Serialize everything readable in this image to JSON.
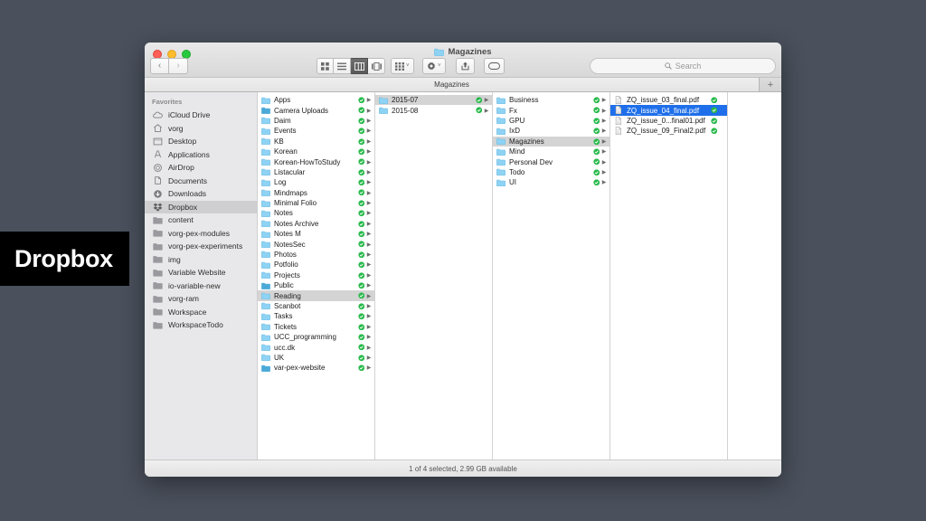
{
  "overlay": {
    "caption": "Dropbox"
  },
  "window": {
    "title": "Magazines",
    "title_icon": "folder-icon",
    "traffic_lights": [
      "close-button",
      "minimize-button",
      "maximize-button"
    ]
  },
  "toolbar": {
    "back_label": "‹",
    "forward_label": "›",
    "view_modes": [
      {
        "name": "icon-view",
        "label": "icon",
        "active": false
      },
      {
        "name": "list-view",
        "label": "list",
        "active": false
      },
      {
        "name": "column-view",
        "label": "column",
        "active": true
      },
      {
        "name": "gallery-view",
        "label": "gallery",
        "active": false
      }
    ],
    "arrange_label": "arrange",
    "action_label": "action",
    "share_label": "share",
    "tag_label": "tag",
    "chevron": "˅"
  },
  "search": {
    "placeholder": "Search",
    "value": "",
    "icon": "search-icon"
  },
  "tabs": {
    "items": [
      {
        "label": "Magazines",
        "active": true
      }
    ],
    "new_tab_label": "+"
  },
  "sidebar": {
    "header": "Favorites",
    "items": [
      {
        "label": "iCloud Drive",
        "icon": "cloud-icon",
        "selected": false
      },
      {
        "label": "vorg",
        "icon": "home-icon",
        "selected": false
      },
      {
        "label": "Desktop",
        "icon": "desktop-icon",
        "selected": false
      },
      {
        "label": "Applications",
        "icon": "applications-icon",
        "selected": false
      },
      {
        "label": "AirDrop",
        "icon": "airdrop-icon",
        "selected": false
      },
      {
        "label": "Documents",
        "icon": "documents-icon",
        "selected": false
      },
      {
        "label": "Downloads",
        "icon": "downloads-icon",
        "selected": false
      },
      {
        "label": "Dropbox",
        "icon": "dropbox-icon",
        "selected": true
      },
      {
        "label": "content",
        "icon": "folder-icon",
        "selected": false
      },
      {
        "label": "vorg-pex-modules",
        "icon": "folder-icon",
        "selected": false
      },
      {
        "label": "vorg-pex-experiments",
        "icon": "folder-icon",
        "selected": false
      },
      {
        "label": "img",
        "icon": "folder-icon",
        "selected": false
      },
      {
        "label": "Variable Website",
        "icon": "folder-icon",
        "selected": false
      },
      {
        "label": "io-variable-new",
        "icon": "folder-icon",
        "selected": false
      },
      {
        "label": "vorg-ram",
        "icon": "folder-icon",
        "selected": false
      },
      {
        "label": "Workspace",
        "icon": "folder-icon",
        "selected": false
      },
      {
        "label": "WorkspaceTodo",
        "icon": "folder-icon",
        "selected": false
      }
    ]
  },
  "columns": [
    {
      "name": "column-1",
      "rows": [
        {
          "label": "Apps",
          "icon": "folder-icon",
          "sync": true,
          "arrow": true,
          "selected": "none"
        },
        {
          "label": "Camera Uploads",
          "icon": "folder-special-icon",
          "sync": true,
          "arrow": true,
          "selected": "none"
        },
        {
          "label": "Daim",
          "icon": "folder-icon",
          "sync": true,
          "arrow": true,
          "selected": "none"
        },
        {
          "label": "Events",
          "icon": "folder-icon",
          "sync": true,
          "arrow": true,
          "selected": "none"
        },
        {
          "label": "KB",
          "icon": "folder-icon",
          "sync": true,
          "arrow": true,
          "selected": "none"
        },
        {
          "label": "Korean",
          "icon": "folder-icon",
          "sync": true,
          "arrow": true,
          "selected": "none"
        },
        {
          "label": "Korean-HowToStudy",
          "icon": "folder-icon",
          "sync": true,
          "arrow": true,
          "selected": "none"
        },
        {
          "label": "Listacular",
          "icon": "folder-icon",
          "sync": true,
          "arrow": true,
          "selected": "none"
        },
        {
          "label": "Log",
          "icon": "folder-icon",
          "sync": true,
          "arrow": true,
          "selected": "none"
        },
        {
          "label": "Mindmaps",
          "icon": "folder-icon",
          "sync": true,
          "arrow": true,
          "selected": "none"
        },
        {
          "label": "Minimal Folio",
          "icon": "folder-icon",
          "sync": true,
          "arrow": true,
          "selected": "none"
        },
        {
          "label": "Notes",
          "icon": "folder-icon",
          "sync": true,
          "arrow": true,
          "selected": "none"
        },
        {
          "label": "Notes Archive",
          "icon": "folder-icon",
          "sync": true,
          "arrow": true,
          "selected": "none"
        },
        {
          "label": "Notes M",
          "icon": "folder-icon",
          "sync": true,
          "arrow": true,
          "selected": "none"
        },
        {
          "label": "NotesSec",
          "icon": "folder-icon",
          "sync": true,
          "arrow": true,
          "selected": "none"
        },
        {
          "label": "Photos",
          "icon": "folder-icon",
          "sync": true,
          "arrow": true,
          "selected": "none"
        },
        {
          "label": "Potfolio",
          "icon": "folder-icon",
          "sync": true,
          "arrow": true,
          "selected": "none"
        },
        {
          "label": "Projects",
          "icon": "folder-icon",
          "sync": true,
          "arrow": true,
          "selected": "none"
        },
        {
          "label": "Public",
          "icon": "folder-special-icon",
          "sync": true,
          "arrow": true,
          "selected": "none"
        },
        {
          "label": "Reading",
          "icon": "folder-icon",
          "sync": true,
          "arrow": true,
          "selected": "gray"
        },
        {
          "label": "Scanbot",
          "icon": "folder-icon",
          "sync": true,
          "arrow": true,
          "selected": "none"
        },
        {
          "label": "Tasks",
          "icon": "folder-icon",
          "sync": true,
          "arrow": true,
          "selected": "none"
        },
        {
          "label": "Tickets",
          "icon": "folder-icon",
          "sync": true,
          "arrow": true,
          "selected": "none"
        },
        {
          "label": "UCC_programming",
          "icon": "folder-icon",
          "sync": true,
          "arrow": true,
          "selected": "none"
        },
        {
          "label": "ucc.dk",
          "icon": "folder-icon",
          "sync": true,
          "arrow": true,
          "selected": "none"
        },
        {
          "label": "UK",
          "icon": "folder-icon",
          "sync": true,
          "arrow": true,
          "selected": "none"
        },
        {
          "label": "var-pex-website",
          "icon": "folder-special-icon",
          "sync": true,
          "arrow": true,
          "selected": "none"
        }
      ]
    },
    {
      "name": "column-2",
      "rows": [
        {
          "label": "2015-07",
          "icon": "folder-icon",
          "sync": true,
          "arrow": true,
          "selected": "gray"
        },
        {
          "label": "2015-08",
          "icon": "folder-icon",
          "sync": true,
          "arrow": true,
          "selected": "none"
        }
      ]
    },
    {
      "name": "column-3",
      "rows": [
        {
          "label": "Business",
          "icon": "folder-icon",
          "sync": true,
          "arrow": true,
          "selected": "none"
        },
        {
          "label": "Fx",
          "icon": "folder-icon",
          "sync": true,
          "arrow": true,
          "selected": "none"
        },
        {
          "label": "GPU",
          "icon": "folder-icon",
          "sync": true,
          "arrow": true,
          "selected": "none"
        },
        {
          "label": "IxD",
          "icon": "folder-icon",
          "sync": true,
          "arrow": true,
          "selected": "none"
        },
        {
          "label": "Magazines",
          "icon": "folder-icon",
          "sync": true,
          "arrow": true,
          "selected": "gray"
        },
        {
          "label": "Mind",
          "icon": "folder-icon",
          "sync": true,
          "arrow": true,
          "selected": "none"
        },
        {
          "label": "Personal Dev",
          "icon": "folder-icon",
          "sync": true,
          "arrow": true,
          "selected": "none"
        },
        {
          "label": "Todo",
          "icon": "folder-icon",
          "sync": true,
          "arrow": true,
          "selected": "none"
        },
        {
          "label": "UI",
          "icon": "folder-icon",
          "sync": true,
          "arrow": true,
          "selected": "none"
        }
      ]
    },
    {
      "name": "column-4",
      "rows": [
        {
          "label": "ZQ_issue_03_final.pdf",
          "icon": "pdf-file-icon",
          "sync": true,
          "arrow": false,
          "selected": "none"
        },
        {
          "label": "ZQ_issue_04_final.pdf",
          "icon": "pdf-file-icon",
          "sync": true,
          "arrow": false,
          "selected": "blue"
        },
        {
          "label": "ZQ_issue_0...final01.pdf",
          "icon": "pdf-file-icon",
          "sync": true,
          "arrow": false,
          "selected": "none"
        },
        {
          "label": "ZQ_issue_09_Final2.pdf",
          "icon": "pdf-file-icon",
          "sync": true,
          "arrow": false,
          "selected": "none"
        }
      ]
    }
  ],
  "status": {
    "text": "1 of 4 selected, 2.99 GB available"
  },
  "colors": {
    "selection_blue": "#1f6fea",
    "sync_green": "#27b94a",
    "folder_blue": "#8fd3f4",
    "desktop_background": "#4a505c"
  }
}
